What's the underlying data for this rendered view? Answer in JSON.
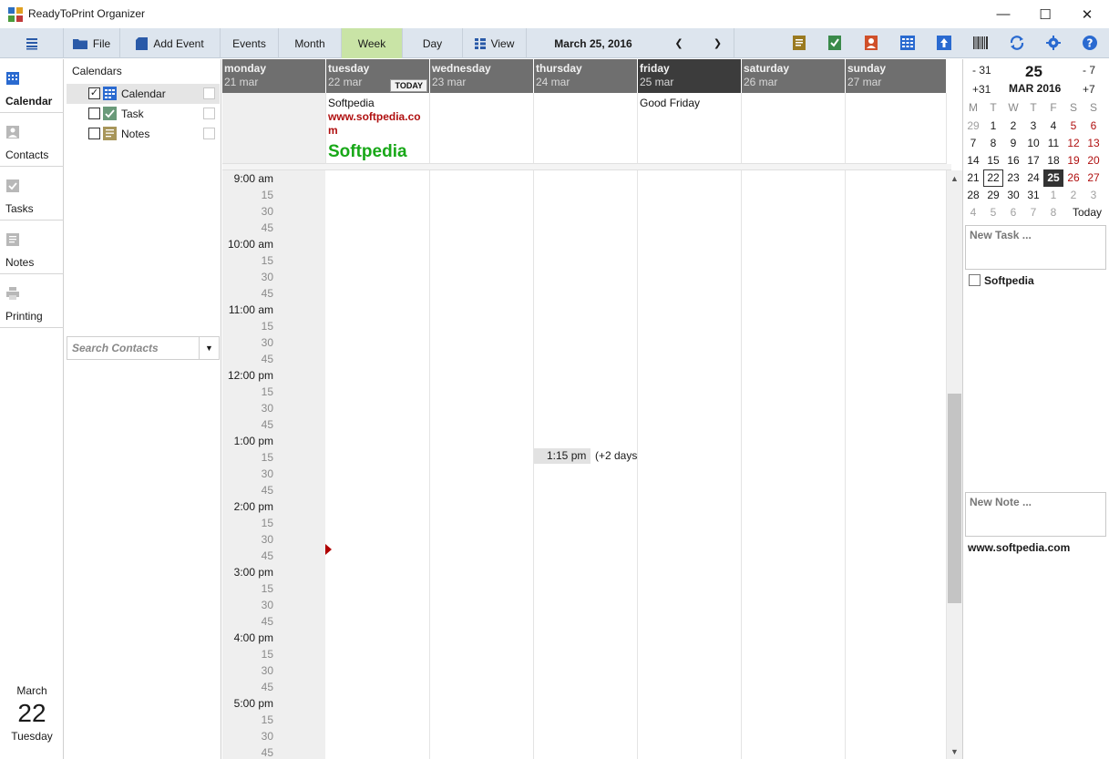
{
  "window": {
    "title": "ReadyToPrint Organizer",
    "minimize": "—",
    "maximize": "☐",
    "close": "✕"
  },
  "toolbar": {
    "file": "File",
    "add_event": "Add Event",
    "events": "Events",
    "month": "Month",
    "week": "Week",
    "day": "Day",
    "view": "View",
    "current_date": "March 25, 2016",
    "prev": "❮",
    "next": "❯",
    "active_view": "Week",
    "icons": [
      "notes-icon",
      "task-icon",
      "contact-icon",
      "calendar-icon",
      "export-icon",
      "barcode-icon",
      "sync-icon",
      "settings-icon",
      "help-icon"
    ]
  },
  "nav": {
    "items": [
      {
        "label": "Calendar",
        "icon": "calendar-icon",
        "active": true
      },
      {
        "label": "Contacts",
        "icon": "contact-icon",
        "active": false
      },
      {
        "label": "Tasks",
        "icon": "task-icon",
        "active": false
      },
      {
        "label": "Notes",
        "icon": "note-icon",
        "active": false
      },
      {
        "label": "Printing",
        "icon": "printer-icon",
        "active": false
      }
    ],
    "today_month": "March",
    "today_day": "22",
    "today_weekday": "Tuesday"
  },
  "calendars": {
    "header": "Calendars",
    "items": [
      {
        "label": "Calendar",
        "checked": true
      },
      {
        "label": "Task",
        "checked": false
      },
      {
        "label": "Notes",
        "checked": false
      }
    ],
    "search_placeholder": "Search Contacts"
  },
  "week": {
    "today_badge": "TODAY",
    "days": [
      {
        "name": "monday",
        "date": "21 mar"
      },
      {
        "name": "tuesday",
        "date": "22 mar"
      },
      {
        "name": "wednesday",
        "date": "23 mar"
      },
      {
        "name": "thursday",
        "date": "24 mar"
      },
      {
        "name": "friday",
        "date": "25 mar"
      },
      {
        "name": "saturday",
        "date": "26 mar"
      },
      {
        "name": "sunday",
        "date": "27 mar"
      }
    ],
    "allday_events": {
      "tuesday": [
        "Softpedia",
        "www.softpedia.com",
        "Softpedia"
      ],
      "friday": [
        "Good Friday"
      ]
    },
    "times": [
      {
        "label": "9:00 am",
        "hour": true
      },
      {
        "label": "15"
      },
      {
        "label": "30"
      },
      {
        "label": "45"
      },
      {
        "label": "10:00 am",
        "hour": true
      },
      {
        "label": "15"
      },
      {
        "label": "30"
      },
      {
        "label": "45"
      },
      {
        "label": "11:00 am",
        "hour": true
      },
      {
        "label": "15"
      },
      {
        "label": "30"
      },
      {
        "label": "45"
      },
      {
        "label": "12:00 pm",
        "hour": true
      },
      {
        "label": "15"
      },
      {
        "label": "30"
      },
      {
        "label": "45"
      },
      {
        "label": "1:00 pm",
        "hour": true
      },
      {
        "label": "15"
      },
      {
        "label": "30"
      },
      {
        "label": "45"
      },
      {
        "label": "2:00 pm",
        "hour": true
      },
      {
        "label": "15"
      },
      {
        "label": "30"
      },
      {
        "label": "45"
      },
      {
        "label": "3:00 pm",
        "hour": true
      },
      {
        "label": "15"
      },
      {
        "label": "30"
      },
      {
        "label": "45"
      },
      {
        "label": "4:00 pm",
        "hour": true
      },
      {
        "label": "15"
      },
      {
        "label": "30"
      },
      {
        "label": "45"
      },
      {
        "label": "5:00 pm",
        "hour": true
      },
      {
        "label": "15"
      },
      {
        "label": "30"
      },
      {
        "label": "45"
      }
    ],
    "timed_event": {
      "time": "1:15 pm",
      "more": "(+2 days"
    }
  },
  "minical": {
    "minus_month": "- 31",
    "plus_month": "+31",
    "minus_week": "- 7",
    "plus_week": "+7",
    "day": "25",
    "month_label": "MAR 2016",
    "weekdays": [
      "M",
      "T",
      "W",
      "T",
      "F",
      "S",
      "S"
    ],
    "weeks": [
      [
        "29",
        "1",
        "2",
        "3",
        "4",
        "5",
        "6"
      ],
      [
        "7",
        "8",
        "9",
        "10",
        "11",
        "12",
        "13"
      ],
      [
        "14",
        "15",
        "16",
        "17",
        "18",
        "19",
        "20"
      ],
      [
        "21",
        "22",
        "23",
        "24",
        "25",
        "26",
        "27"
      ],
      [
        "28",
        "29",
        "30",
        "31",
        "1",
        "2",
        "3"
      ],
      [
        "4",
        "5",
        "6",
        "7",
        "8",
        "",
        ""
      ]
    ],
    "today_label": "Today",
    "today_date": "22",
    "selected_date": "25"
  },
  "tasks": {
    "new_placeholder": "New Task ...",
    "items": [
      {
        "label": "Softpedia",
        "done": false
      }
    ]
  },
  "notes": {
    "new_placeholder": "New Note ...",
    "footer": "www.softpedia.com"
  }
}
